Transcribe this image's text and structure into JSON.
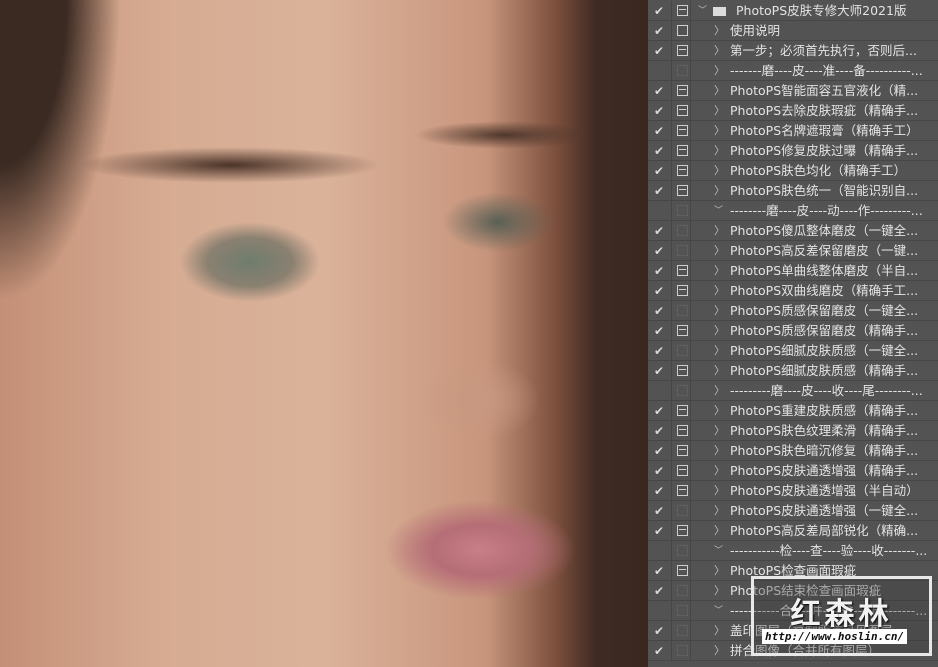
{
  "actions_panel": {
    "rows": [
      {
        "label": "PhotoPS皮肤专修大师2021版",
        "checked": true,
        "dialog": "dialog",
        "expand": "open",
        "folder": true
      },
      {
        "label": "使用说明",
        "checked": true,
        "dialog": "plain",
        "expand": "closed"
      },
      {
        "label": "第一步；必须首先执行，否则后...",
        "checked": true,
        "dialog": "dialog",
        "expand": "closed"
      },
      {
        "label": "-------磨----皮----准----备----------...",
        "checked": false,
        "dialog": "none",
        "expand": "closed"
      },
      {
        "label": "PhotoPS智能面容五官液化（精...",
        "checked": true,
        "dialog": "dialog",
        "expand": "closed"
      },
      {
        "label": "PhotoPS去除皮肤瑕疵（精确手...",
        "checked": true,
        "dialog": "dialog",
        "expand": "closed"
      },
      {
        "label": "PhotoPS名牌遮瑕膏（精确手工）",
        "checked": true,
        "dialog": "dialog",
        "expand": "closed"
      },
      {
        "label": "PhotoPS修复皮肤过曝（精确手...",
        "checked": true,
        "dialog": "dialog",
        "expand": "closed"
      },
      {
        "label": "PhotoPS肤色均化（精确手工）",
        "checked": true,
        "dialog": "dialog",
        "expand": "closed"
      },
      {
        "label": "PhotoPS肤色统一（智能识别自...",
        "checked": true,
        "dialog": "dialog",
        "expand": "closed"
      },
      {
        "label": "--------磨----皮----动----作---------...",
        "checked": false,
        "dialog": "none",
        "expand": "open"
      },
      {
        "label": "PhotoPS傻瓜整体磨皮（一键全...",
        "checked": true,
        "dialog": "none",
        "expand": "closed"
      },
      {
        "label": "PhotoPS高反差保留磨皮（一键...",
        "checked": true,
        "dialog": "none",
        "expand": "closed"
      },
      {
        "label": "PhotoPS单曲线整体磨皮（半自...",
        "checked": true,
        "dialog": "dialog",
        "expand": "closed"
      },
      {
        "label": "PhotoPS双曲线磨皮（精确手工...",
        "checked": true,
        "dialog": "dialog",
        "expand": "closed"
      },
      {
        "label": "PhotoPS质感保留磨皮（一键全...",
        "checked": true,
        "dialog": "none",
        "expand": "closed"
      },
      {
        "label": "PhotoPS质感保留磨皮（精确手...",
        "checked": true,
        "dialog": "dialog",
        "expand": "closed"
      },
      {
        "label": "PhotoPS细腻皮肤质感（一键全...",
        "checked": true,
        "dialog": "none",
        "expand": "closed"
      },
      {
        "label": "PhotoPS细腻皮肤质感（精确手...",
        "checked": true,
        "dialog": "dialog",
        "expand": "closed"
      },
      {
        "label": "---------磨----皮----收----尾--------...",
        "checked": false,
        "dialog": "none",
        "expand": "closed"
      },
      {
        "label": "PhotoPS重建皮肤质感（精确手...",
        "checked": true,
        "dialog": "dialog",
        "expand": "closed"
      },
      {
        "label": "PhotoPS肤色纹理柔滑（精确手...",
        "checked": true,
        "dialog": "dialog",
        "expand": "closed"
      },
      {
        "label": "PhotoPS肤色暗沉修复（精确手...",
        "checked": true,
        "dialog": "dialog",
        "expand": "closed"
      },
      {
        "label": "PhotoPS皮肤通透增强（精确手...",
        "checked": true,
        "dialog": "dialog",
        "expand": "closed"
      },
      {
        "label": "PhotoPS皮肤通透增强（半自动）",
        "checked": true,
        "dialog": "dialog",
        "expand": "closed"
      },
      {
        "label": "PhotoPS皮肤通透增强（一键全...",
        "checked": true,
        "dialog": "none",
        "expand": "closed"
      },
      {
        "label": "PhotoPS高反差局部锐化（精确...",
        "checked": true,
        "dialog": "dialog",
        "expand": "closed"
      },
      {
        "label": "-----------检----查----验----收-------...",
        "checked": false,
        "dialog": "none",
        "expand": "open"
      },
      {
        "label": "PhotoPS检查画面瑕疵",
        "checked": true,
        "dialog": "dialog",
        "expand": "closed"
      },
      {
        "label": "PhotoPS结束检查画面瑕疵",
        "checked": true,
        "dialog": "none",
        "expand": "closed"
      },
      {
        "label": "-----------合----并----输----出-------...",
        "checked": false,
        "dialog": "none",
        "expand": "open"
      },
      {
        "label": "盖印图层（复制所有可见图层...",
        "checked": true,
        "dialog": "none",
        "expand": "closed"
      },
      {
        "label": "拼合图像（合并所有图层）",
        "checked": true,
        "dialog": "none",
        "expand": "closed"
      }
    ]
  },
  "watermark": {
    "title": "红森林",
    "url": "http://www.hoslin.cn/"
  },
  "icons": {
    "check": "checkmark-icon",
    "dialog": "dialog-toggle-icon",
    "open": "chevron-down-icon",
    "closed": "chevron-right-icon",
    "folder": "folder-icon"
  },
  "colors": {
    "panel_bg": "#535353",
    "text": "#e4e4e4"
  }
}
